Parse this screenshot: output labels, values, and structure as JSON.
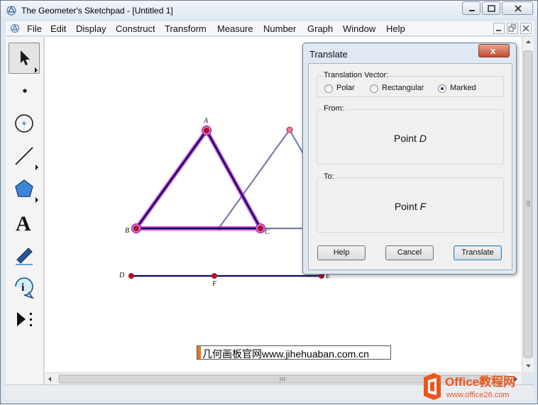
{
  "window": {
    "title": "The Geometer's Sketchpad - [Untitled 1]"
  },
  "menu": {
    "items": [
      "File",
      "Edit",
      "Display",
      "Construct",
      "Transform",
      "Measure",
      "Number",
      "Graph",
      "Window",
      "Help"
    ]
  },
  "toolbox": {
    "tools": [
      "arrow-select-tool",
      "point-tool",
      "compass-tool",
      "straightedge-tool",
      "polygon-tool",
      "text-tool",
      "marker-tool",
      "information-tool",
      "custom-tools"
    ],
    "text_tool_glyph": "A"
  },
  "sketch": {
    "points": {
      "A": "A",
      "B": "B",
      "C": "C",
      "D": "D",
      "F": "F",
      "E": "E"
    },
    "highlight_color": "#c23bd6",
    "segment_color": "#0c0c55",
    "translated_color": "#7a7ab0"
  },
  "dialog": {
    "title": "Translate",
    "close_glyph": "x",
    "vector_legend": "Translation Vector:",
    "options": [
      {
        "label": "Polar",
        "selected": false
      },
      {
        "label": "Rectangular",
        "selected": false
      },
      {
        "label": "Marked",
        "selected": true
      }
    ],
    "from_legend": "From:",
    "from_prefix": "Point ",
    "from_point": "D",
    "to_legend": "To:",
    "to_prefix": "Point ",
    "to_point": "F",
    "buttons": {
      "help": "Help",
      "cancel": "Cancel",
      "translate": "Translate"
    }
  },
  "watermark": {
    "text": "几何画板官网www.jihehuaban.com.cn"
  },
  "logo": {
    "brand": "Office教程网",
    "url": "www.office26.com"
  }
}
